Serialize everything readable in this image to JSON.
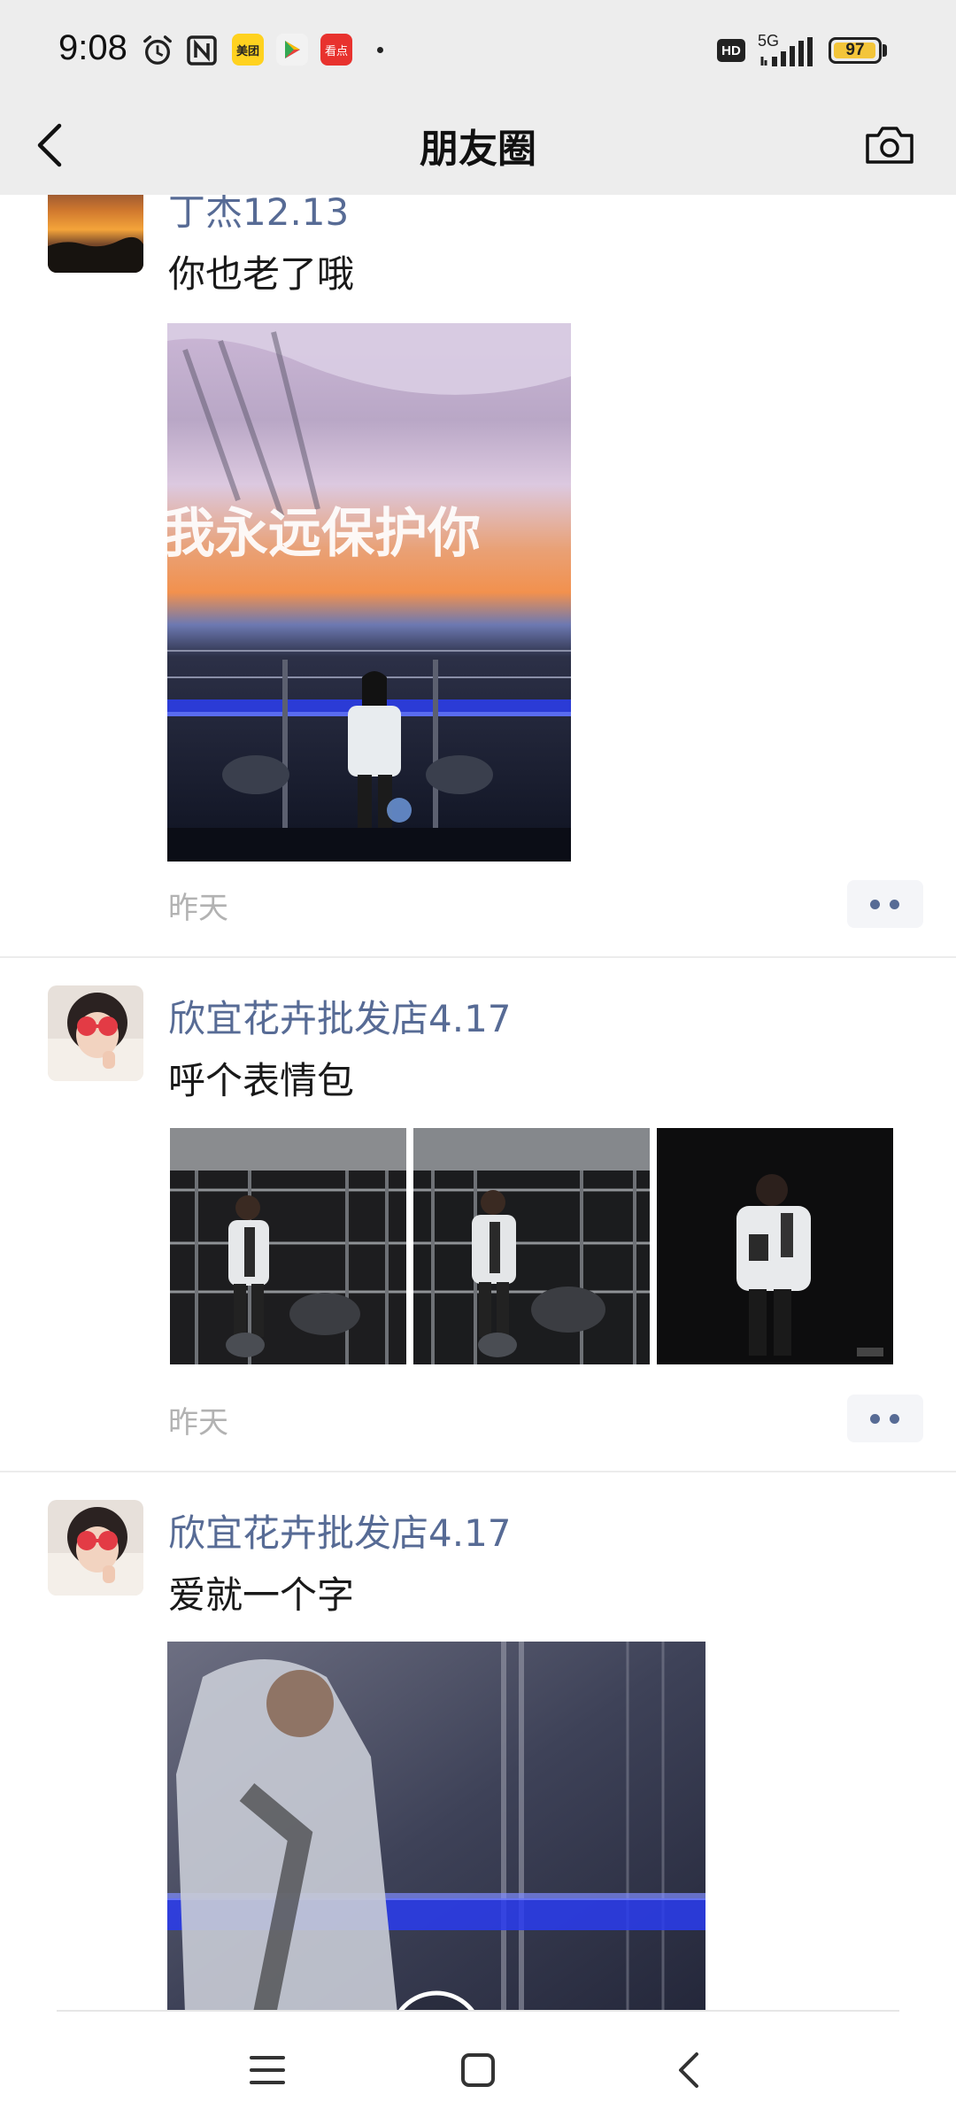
{
  "status_bar": {
    "time": "9:08",
    "icons": [
      "alarm-icon",
      "nfc-icon",
      "meituan-app-icon",
      "play-store-icon",
      "kandian-app-icon"
    ],
    "meituan_label": "美团",
    "kandian_label": "看点",
    "hd_label": "HD",
    "network_label": "5G",
    "battery_level": 97,
    "battery_text": "97",
    "colors": {
      "battery_fill": "#f3c53a",
      "background": "#ededed"
    }
  },
  "nav": {
    "title": "朋友圈",
    "back_icon": "chevron-left-icon",
    "camera_icon": "camera-icon"
  },
  "feed": {
    "link_color": "#576b95",
    "posts": [
      {
        "name": "丁杰12.13",
        "text": "你也老了哦",
        "image_caption": "我永远保护你",
        "time": "昨天"
      },
      {
        "name": "欣宜花卉批发店4.17",
        "text": "呼个表情包",
        "time": "昨天"
      },
      {
        "name": "欣宜花卉批发店4.17",
        "text": "爱就一个字",
        "media_type": "video"
      }
    ]
  },
  "system_nav": {
    "icons": [
      "menu-icon",
      "home-icon",
      "back-icon"
    ]
  }
}
